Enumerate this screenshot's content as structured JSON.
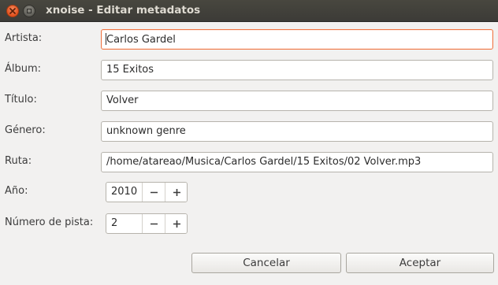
{
  "window": {
    "title": "xnoise - Editar metadatos"
  },
  "fields": {
    "artist": {
      "label": "Artista:",
      "value": "Carlos Gardel"
    },
    "album": {
      "label": "Álbum:",
      "value": "15 Exitos"
    },
    "title": {
      "label": "Título:",
      "value": "Volver"
    },
    "genre": {
      "label": "Género:",
      "value": "unknown genre"
    },
    "path": {
      "label": "Ruta:",
      "value": "/home/atareao/Musica/Carlos Gardel/15 Exitos/02 Volver.mp3"
    },
    "year": {
      "label": "Año:",
      "value": "2010"
    },
    "track": {
      "label": "Número de pista:",
      "value": "2"
    }
  },
  "buttons": {
    "cancel": "Cancelar",
    "accept": "Aceptar"
  },
  "colors": {
    "titlebar": "#3c3b37",
    "close_button": "#e2511e",
    "focus_border": "#f07746",
    "window_bg": "#f2f1f0"
  },
  "icons": {
    "close": "close-icon",
    "maximize": "maximize-icon",
    "decrement": "minus-icon",
    "increment": "plus-icon"
  }
}
